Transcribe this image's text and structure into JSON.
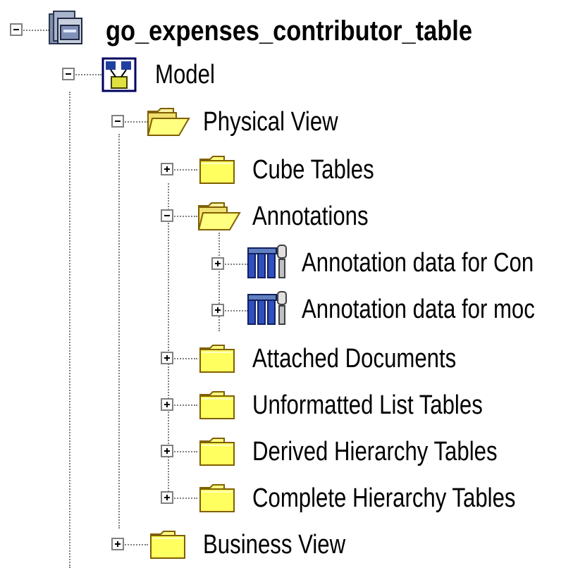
{
  "tree": {
    "root": {
      "label": "go_expenses_contributor_table",
      "icon": "database-icon",
      "expanded": true
    },
    "model": {
      "label": "Model",
      "icon": "model-icon",
      "expanded": true
    },
    "physical_view": {
      "label": "Physical View",
      "icon": "folder-open-icon",
      "expanded": true
    },
    "cube_tables": {
      "label": "Cube Tables",
      "icon": "folder-closed-icon",
      "expanded": false
    },
    "annotations": {
      "label": "Annotations",
      "icon": "folder-open-icon",
      "expanded": true
    },
    "annotation_data_1": {
      "label": "Annotation data for Con",
      "icon": "annotation-table-icon",
      "expanded": false
    },
    "annotation_data_2": {
      "label": "Annotation data for moc",
      "icon": "annotation-table-icon",
      "expanded": false
    },
    "attached_documents": {
      "label": "Attached Documents",
      "icon": "folder-closed-icon",
      "expanded": false
    },
    "unformatted_list_tables": {
      "label": "Unformatted List Tables",
      "icon": "folder-closed-icon",
      "expanded": false
    },
    "derived_hierarchy_tables": {
      "label": "Derived Hierarchy Tables",
      "icon": "folder-closed-icon",
      "expanded": false
    },
    "complete_hierarchy_tables": {
      "label": "Complete Hierarchy Tables",
      "icon": "folder-closed-icon",
      "expanded": false
    },
    "business_view": {
      "label": "Business View",
      "icon": "folder-closed-icon",
      "expanded": false
    }
  }
}
